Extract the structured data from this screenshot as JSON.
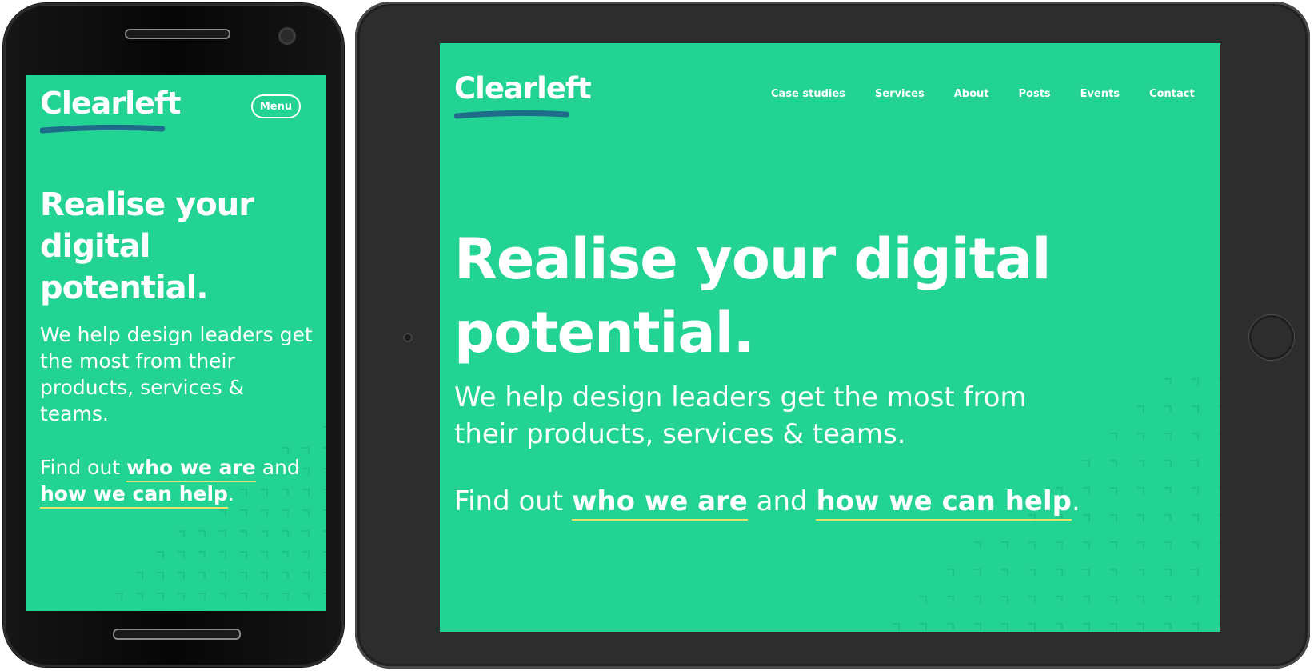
{
  "brand": {
    "name": "Clearleft",
    "background_color": "#22d394",
    "text_color": "#ffffff",
    "swoosh_color": "#1f6b8a",
    "link_underline_color": "#e6e36a"
  },
  "mobile": {
    "menu_label": "Menu",
    "hero": {
      "heading": "Realise your digital potential.",
      "subheading": "We help design leaders get the most from their products, services & teams.",
      "cta_prefix": "Find out",
      "cta_link_1": "who we are",
      "cta_conjunction": "and",
      "cta_link_2": "how we can help",
      "cta_suffix": "."
    }
  },
  "tablet": {
    "nav": {
      "items": [
        {
          "label": "Case studies"
        },
        {
          "label": "Services"
        },
        {
          "label": "About"
        },
        {
          "label": "Posts"
        },
        {
          "label": "Events"
        },
        {
          "label": "Contact"
        }
      ]
    },
    "hero": {
      "heading": "Realise your digital potential.",
      "subheading": "We help design leaders get the most from their products, services & teams.",
      "cta_prefix": "Find out",
      "cta_link_1": "who we are",
      "cta_conjunction": "and",
      "cta_link_2": "how we can help",
      "cta_suffix": "."
    }
  }
}
